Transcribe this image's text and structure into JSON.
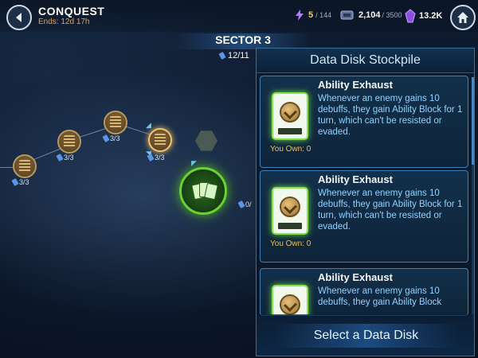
{
  "header": {
    "title": "CONQUEST",
    "ends": "Ends: 12d 17h",
    "energy": {
      "value": "5",
      "max": "/ 144"
    },
    "keys": {
      "value": "2,104",
      "max": "/ 3500"
    },
    "crystals": {
      "value": "13.2K"
    }
  },
  "map": {
    "sector": "SECTOR 3",
    "progress": "12/11",
    "nodes": [
      {
        "label": "3/3"
      },
      {
        "label": "3/3"
      },
      {
        "label": "3/3"
      },
      {
        "label": "3/3"
      }
    ],
    "side_label": "0/"
  },
  "panel": {
    "title": "Data Disk Stockpile",
    "items": [
      {
        "name": "Ability Exhaust",
        "desc": "Whenever an enemy gains 10 debuffs, they gain Ability Block for 1 turn, which can't be resisted or evaded.",
        "owned": "You Own: 0"
      },
      {
        "name": "Ability Exhaust",
        "desc": "Whenever an enemy gains 10 debuffs, they gain Ability Block for 1 turn, which can't be resisted or evaded.",
        "owned": "You Own: 0"
      },
      {
        "name": "Ability Exhaust",
        "desc": "Whenever an enemy gains 10 debuffs, they gain Ability Block",
        "owned": ""
      }
    ],
    "select_label": "Select a Data Disk"
  },
  "colors": {
    "accent": "#8fd3ff",
    "owned": "#f2c24a",
    "ends": "#e8a04a",
    "disk_glow": "#6ad43a"
  }
}
